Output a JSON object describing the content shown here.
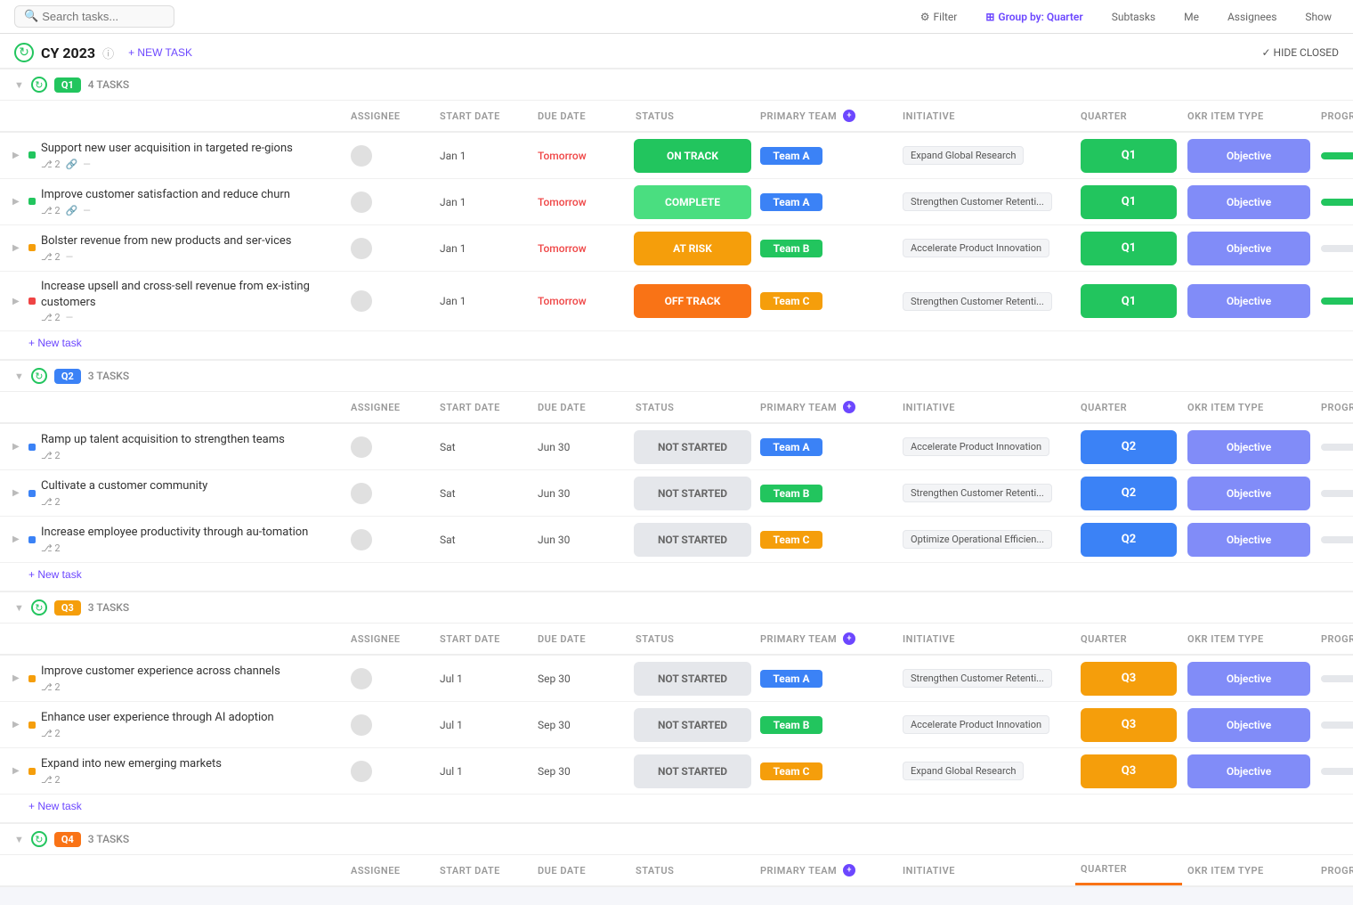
{
  "topbar": {
    "search_placeholder": "Search tasks...",
    "filter_label": "Filter",
    "group_by_label": "Group by: Quarter",
    "subtasks_label": "Subtasks",
    "me_label": "Me",
    "assignees_label": "Assignees",
    "show_label": "Show"
  },
  "page": {
    "title": "CY 2023",
    "new_task_label": "+ NEW TASK",
    "hide_closed_label": "✓ HIDE CLOSED"
  },
  "quarters": [
    {
      "id": "Q1",
      "badge_class": "q1-badge",
      "qv_class": "qv1",
      "task_count": "4 TASKS",
      "header_color": "#22c55e",
      "tasks": [
        {
          "name": "Support new user acquisition in targeted re-gions",
          "subtask_count": "2",
          "has_link": true,
          "has_dash": true,
          "assignee": "",
          "start_date": "Jan 1",
          "due_date": "Tomorrow",
          "due_class": "date-tomorrow",
          "status": "ON TRACK",
          "status_class": "status-on-track",
          "team": "Team A",
          "team_class": "team-a",
          "initiative": "Expand Global Research",
          "quarter": "Q1",
          "okr_type": "Objective",
          "progress": 50,
          "dot_class": "dot-green"
        },
        {
          "name": "Improve customer satisfaction and reduce churn",
          "subtask_count": "2",
          "has_link": true,
          "has_dash": true,
          "assignee": "",
          "start_date": "Jan 1",
          "due_date": "Tomorrow",
          "due_class": "date-tomorrow",
          "status": "COMPLETE",
          "status_class": "status-complete",
          "team": "Team A",
          "team_class": "team-a",
          "initiative": "Strengthen Customer Retenti...",
          "quarter": "Q1",
          "okr_type": "Objective",
          "progress": 100,
          "dot_class": "dot-green"
        },
        {
          "name": "Bolster revenue from new products and ser-vices",
          "subtask_count": "2",
          "has_link": false,
          "has_dash": true,
          "assignee": "",
          "start_date": "Jan 1",
          "due_date": "Tomorrow",
          "due_class": "date-tomorrow",
          "status": "AT RISK",
          "status_class": "status-at-risk",
          "team": "Team B",
          "team_class": "team-b",
          "initiative": "Accelerate Product Innovation",
          "quarter": "Q1",
          "okr_type": "Objective",
          "progress": 0,
          "dot_class": "dot-orange"
        },
        {
          "name": "Increase upsell and cross-sell revenue from ex-isting customers",
          "subtask_count": "2",
          "has_link": false,
          "has_dash": true,
          "assignee": "",
          "start_date": "Jan 1",
          "due_date": "Tomorrow",
          "due_class": "date-tomorrow",
          "status": "OFF TRACK",
          "status_class": "status-off-track",
          "team": "Team C",
          "team_class": "team-c",
          "initiative": "Strengthen Customer Retenti...",
          "quarter": "Q1",
          "okr_type": "Objective",
          "progress": 50,
          "dot_class": "dot-red"
        }
      ]
    },
    {
      "id": "Q2",
      "badge_class": "q2-badge",
      "qv_class": "qv2",
      "task_count": "3 TASKS",
      "tasks": [
        {
          "name": "Ramp up talent acquisition to strengthen teams",
          "subtask_count": "2",
          "has_link": false,
          "has_dash": false,
          "assignee": "",
          "start_date": "Sat",
          "due_date": "Jun 30",
          "due_class": "",
          "status": "NOT STARTED",
          "status_class": "status-not-started",
          "team": "Team A",
          "team_class": "team-a",
          "initiative": "Accelerate Product Innovation",
          "quarter": "Q2",
          "okr_type": "Objective",
          "progress": 0,
          "dot_class": "dot-blue"
        },
        {
          "name": "Cultivate a customer community",
          "subtask_count": "2",
          "has_link": false,
          "has_dash": false,
          "assignee": "",
          "start_date": "Sat",
          "due_date": "Jun 30",
          "due_class": "",
          "status": "NOT STARTED",
          "status_class": "status-not-started",
          "team": "Team B",
          "team_class": "team-b",
          "initiative": "Strengthen Customer Retenti...",
          "quarter": "Q2",
          "okr_type": "Objective",
          "progress": 0,
          "dot_class": "dot-blue"
        },
        {
          "name": "Increase employee productivity through au-tomation",
          "subtask_count": "2",
          "has_link": false,
          "has_dash": false,
          "assignee": "",
          "start_date": "Sat",
          "due_date": "Jun 30",
          "due_class": "",
          "status": "NOT STARTED",
          "status_class": "status-not-started",
          "team": "Team C",
          "team_class": "team-c",
          "initiative": "Optimize Operational Efficien...",
          "quarter": "Q2",
          "okr_type": "Objective",
          "progress": 0,
          "dot_class": "dot-blue"
        }
      ]
    },
    {
      "id": "Q3",
      "badge_class": "q3-badge",
      "qv_class": "qv3",
      "task_count": "3 TASKS",
      "tasks": [
        {
          "name": "Improve customer experience across channels",
          "subtask_count": "2",
          "has_link": false,
          "has_dash": false,
          "assignee": "",
          "start_date": "Jul 1",
          "due_date": "Sep 30",
          "due_class": "",
          "status": "NOT STARTED",
          "status_class": "status-not-started",
          "team": "Team A",
          "team_class": "team-a",
          "initiative": "Strengthen Customer Retenti...",
          "quarter": "Q3",
          "okr_type": "Objective",
          "progress": 0,
          "dot_class": "dot-orange"
        },
        {
          "name": "Enhance user experience through AI adoption",
          "subtask_count": "2",
          "has_link": false,
          "has_dash": false,
          "assignee": "",
          "start_date": "Jul 1",
          "due_date": "Sep 30",
          "due_class": "",
          "status": "NOT STARTED",
          "status_class": "status-not-started",
          "team": "Team B",
          "team_class": "team-b",
          "initiative": "Accelerate Product Innovation",
          "quarter": "Q3",
          "okr_type": "Objective",
          "progress": 0,
          "dot_class": "dot-orange"
        },
        {
          "name": "Expand into new emerging markets",
          "subtask_count": "2",
          "has_link": false,
          "has_dash": false,
          "assignee": "",
          "start_date": "Jul 1",
          "due_date": "Sep 30",
          "due_class": "",
          "status": "NOT STARTED",
          "status_class": "status-not-started",
          "team": "Team C",
          "team_class": "team-c",
          "initiative": "Expand Global Research",
          "quarter": "Q3",
          "okr_type": "Objective",
          "progress": 0,
          "dot_class": "dot-orange"
        }
      ]
    },
    {
      "id": "Q4",
      "badge_class": "q4-badge",
      "qv_class": "qv4",
      "task_count": "3 TASKS",
      "tasks": []
    }
  ],
  "columns": {
    "task": "",
    "assignee": "ASSIGNEE",
    "start_date": "START DATE",
    "due_date": "DUE DATE",
    "status": "STATUS",
    "primary_team": "PRIMARY TEAM",
    "initiative": "INITIATIVE",
    "quarter": "QUARTER",
    "okr_item_type": "OKR ITEM TYPE",
    "progress": "PROGRESS"
  }
}
